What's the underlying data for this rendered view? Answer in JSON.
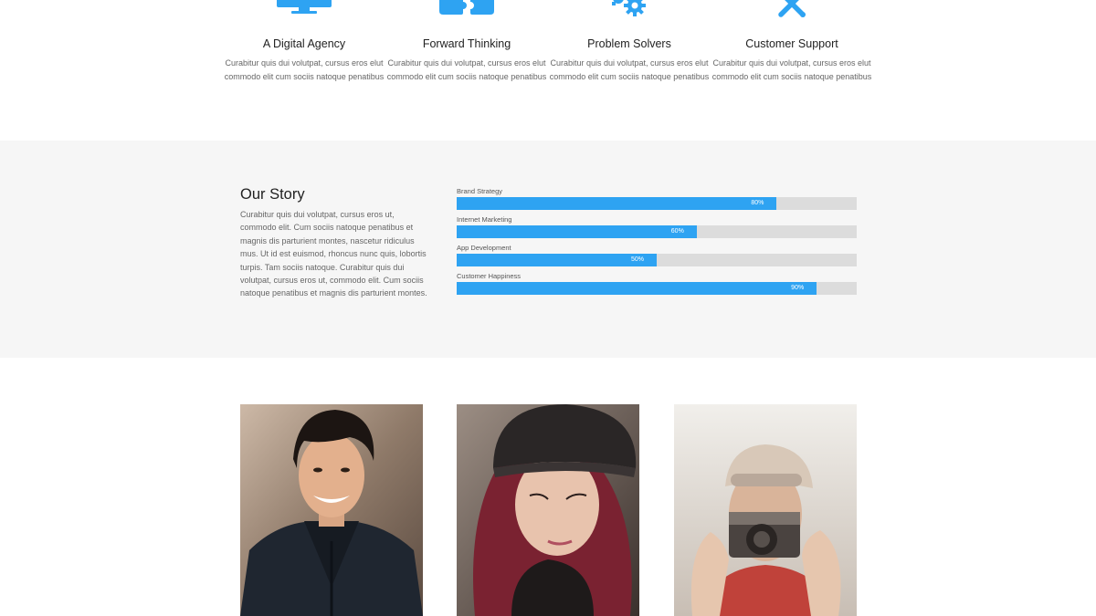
{
  "colors": {
    "accent": "#2ea3f2",
    "section_bg": "#f6f6f6",
    "track": "#dcdcdc"
  },
  "features": [
    {
      "icon": "monitor-icon",
      "title": "A Digital Agency",
      "text": "Curabitur quis dui volutpat, cursus eros elut commodo elit cum sociis natoque penatibus"
    },
    {
      "icon": "puzzle-icon",
      "title": "Forward Thinking",
      "text": "Curabitur quis dui volutpat, cursus eros elut commodo elit cum sociis natoque penatibus"
    },
    {
      "icon": "gears-icon",
      "title": "Problem Solvers",
      "text": "Curabitur quis dui volutpat, cursus eros elut commodo elit cum sociis natoque penatibus"
    },
    {
      "icon": "tools-icon",
      "title": "Customer Support",
      "text": "Curabitur quis dui volutpat, cursus eros elut commodo elit cum sociis natoque penatibus"
    }
  ],
  "story": {
    "title": "Our Story",
    "text": "Curabitur quis dui volutpat, cursus eros ut, commodo elit. Cum sociis natoque penatibus et magnis dis parturient montes, nascetur ridiculus mus. Ut id est euismod, rhoncus nunc quis, lobortis turpis. Tam sociis natoque. Curabitur quis dui volutpat, cursus eros ut, commodo elit. Cum sociis natoque penatibus et magnis dis parturient montes."
  },
  "skills": [
    {
      "label": "Brand Strategy",
      "percent": 80,
      "percent_text": "80%"
    },
    {
      "label": "Internet Marketing",
      "percent": 60,
      "percent_text": "60%"
    },
    {
      "label": "App Development",
      "percent": 50,
      "percent_text": "50%"
    },
    {
      "label": "Customer Happiness",
      "percent": 90,
      "percent_text": "90%"
    }
  ],
  "team": [
    {
      "name": "team-photo-man"
    },
    {
      "name": "team-photo-woman"
    },
    {
      "name": "team-photo-photographer"
    }
  ]
}
